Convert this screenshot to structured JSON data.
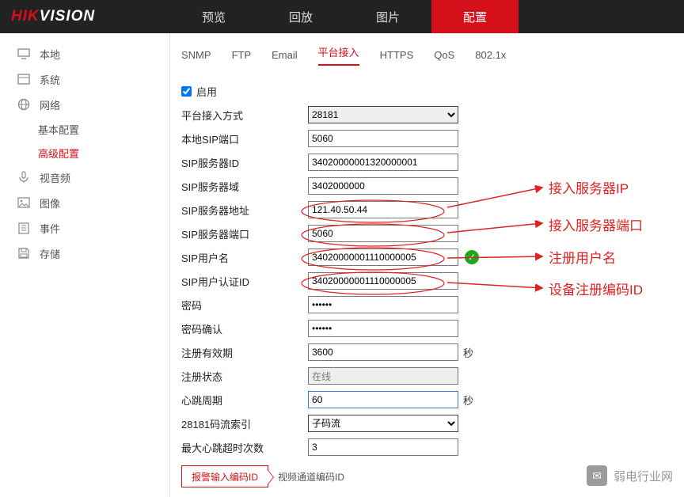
{
  "brand": {
    "part1": "HIK",
    "part2": "VISION"
  },
  "topnav": {
    "items": [
      "预览",
      "回放",
      "图片",
      "配置"
    ],
    "activeIndex": 3
  },
  "sidebar": {
    "items": [
      {
        "icon": "monitor",
        "label": "本地"
      },
      {
        "icon": "system",
        "label": "系统"
      },
      {
        "icon": "globe",
        "label": "网络",
        "children": [
          {
            "label": "基本配置"
          },
          {
            "label": "高级配置",
            "active": true
          }
        ]
      },
      {
        "icon": "mic",
        "label": "视音频"
      },
      {
        "icon": "image",
        "label": "图像"
      },
      {
        "icon": "event",
        "label": "事件"
      },
      {
        "icon": "save",
        "label": "存储"
      }
    ]
  },
  "tabs": {
    "items": [
      "SNMP",
      "FTP",
      "Email",
      "平台接入",
      "HTTPS",
      "QoS",
      "802.1x"
    ],
    "activeIndex": 3
  },
  "form": {
    "enable_label": "启用",
    "enable_checked": true,
    "access_mode_label": "平台接入方式",
    "access_mode_value": "28181",
    "local_sip_port_label": "本地SIP端口",
    "local_sip_port_value": "5060",
    "sip_server_id_label": "SIP服务器ID",
    "sip_server_id_value": "34020000001320000001",
    "sip_server_domain_label": "SIP服务器域",
    "sip_server_domain_value": "3402000000",
    "sip_server_addr_label": "SIP服务器地址",
    "sip_server_addr_value": "121.40.50.44",
    "sip_server_port_label": "SIP服务器端口",
    "sip_server_port_value": "5060",
    "sip_user_label": "SIP用户名",
    "sip_user_value": "34020000001110000005",
    "sip_auth_id_label": "SIP用户认证ID",
    "sip_auth_id_value": "34020000001110000005",
    "password_label": "密码",
    "password_value": "••••••",
    "password2_label": "密码确认",
    "password2_value": "••••••",
    "reg_valid_label": "注册有效期",
    "reg_valid_value": "3600",
    "reg_status_label": "注册状态",
    "reg_status_value": "在线",
    "heartbeat_label": "心跳周期",
    "heartbeat_value": "60",
    "stream_index_label": "28181码流索引",
    "stream_index_value": "子码流",
    "max_timeout_label": "最大心跳超时次数",
    "max_timeout_value": "3",
    "unit_seconds": "秒"
  },
  "bottomTabs": {
    "active": "报警输入编码ID",
    "other": "视频通道编码ID"
  },
  "annotations": {
    "server_ip": "接入服务器IP",
    "server_port": "接入服务器端口",
    "reg_user": "注册用户名",
    "device_id": "设备注册编码ID"
  },
  "watermark": "弱电行业网"
}
